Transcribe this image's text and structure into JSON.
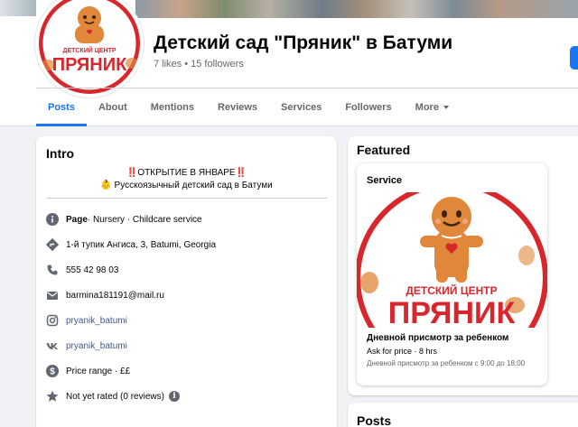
{
  "header": {
    "page_name": "Детский сад \"Пряник\" в Батуми",
    "stats": "7 likes • 15 followers",
    "logo": {
      "small_text": "ДЕТСКИЙ ЦЕНТР",
      "big_text": "ПРЯНИК"
    }
  },
  "tabs": [
    "Posts",
    "About",
    "Mentions",
    "Reviews",
    "Services",
    "Followers",
    "More"
  ],
  "active_tab": "Posts",
  "intro": {
    "title": "Intro",
    "bio_line1": "‼️ОТКРЫТИЕ В ЯНВАРЕ‼️",
    "bio_line2": "👶 Русскоязычный детский сад в Батуми",
    "page_label": "Page",
    "page_category": " · Nursery · Childcare service",
    "address": "1-й тупик Ангиса, 3, Batumi, Georgia",
    "phone": "555 42 98 03",
    "email": "barmina181191@mail.ru",
    "instagram": "pryanik_batumi",
    "vk": "pryanik_batumi",
    "price_range": "Price range · ££",
    "rating": "Not yet rated (0 reviews)"
  },
  "featured": {
    "title": "Featured",
    "card": {
      "label": "Service",
      "name": "Дневной присмотр за ребенком",
      "price": "Ask for price · 8 hrs",
      "description": "Дневной присмотр за ребенком с 9:00 до 18:00"
    }
  },
  "posts": {
    "title": "Posts"
  },
  "colors": {
    "accent": "#1877f2",
    "logo_red": "#d8262d",
    "gingerbread": "#e0873a"
  }
}
